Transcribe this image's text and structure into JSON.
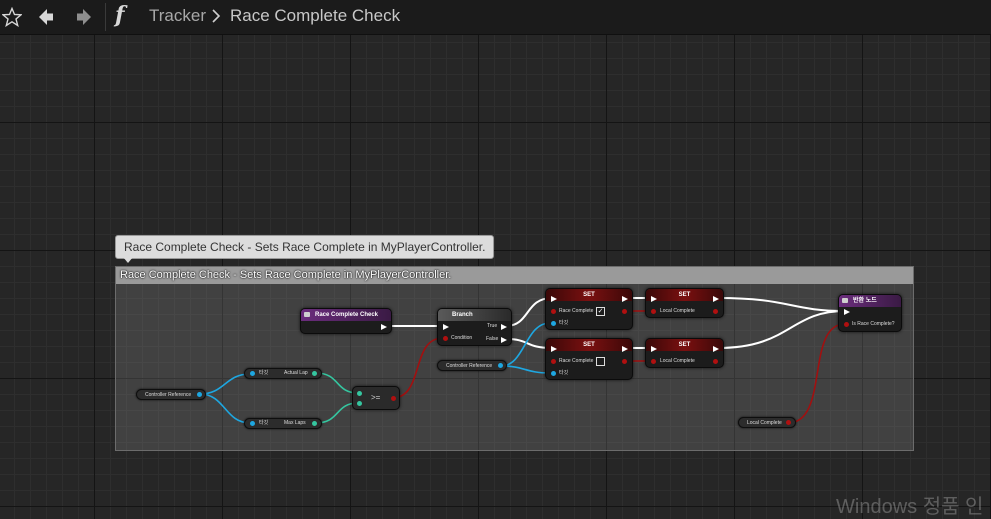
{
  "toolbar": {
    "favorite_icon": "star-icon",
    "back_icon": "arrow-left-icon",
    "forward_icon": "arrow-right-icon",
    "function_icon": "function-icon",
    "function_symbol": "f"
  },
  "breadcrumb": {
    "parent": "Tracker",
    "current": "Race Complete Check"
  },
  "comment": {
    "bubble": "Race Complete Check - Sets Race Complete in MyPlayerController.",
    "title": "Race Complete Check - Sets Race Complete in MyPlayerController."
  },
  "nodes": {
    "entry": {
      "title": "Race Complete Check"
    },
    "controller_ref_1": {
      "label": "Controller Reference"
    },
    "actual_lap": {
      "target": "타깃",
      "label": "Actual Lap"
    },
    "max_laps": {
      "target": "타깃",
      "label": "Max Laps"
    },
    "compare": {
      "op": ">="
    },
    "branch": {
      "title": "Branch",
      "true_label": "True",
      "false_label": "False",
      "condition_label": "Condition"
    },
    "controller_ref_2": {
      "label": "Controller Reference"
    },
    "set_1": {
      "title": "SET",
      "pin_label": "Race Complete",
      "target": "타깃",
      "checked": true
    },
    "set_2": {
      "title": "SET",
      "pin_label": "Race Complete",
      "target": "타깃",
      "checked": false
    },
    "set_local_1": {
      "title": "SET",
      "pin_label": "Local Complete"
    },
    "set_local_2": {
      "title": "SET",
      "pin_label": "Local Complete"
    },
    "return": {
      "title": "반환 노드",
      "pin_label": "Is Race Complete?"
    },
    "local_complete": {
      "label": "Local Complete"
    }
  },
  "colors": {
    "exec_wire": "#ffffff",
    "bool_wire": "#a01010",
    "object_wire": "#1ea7e1",
    "int_wire": "#35c6a0",
    "function_header": "#6b2d7d",
    "set_header": "#7a1010"
  },
  "watermark": "Windows 정품 인"
}
